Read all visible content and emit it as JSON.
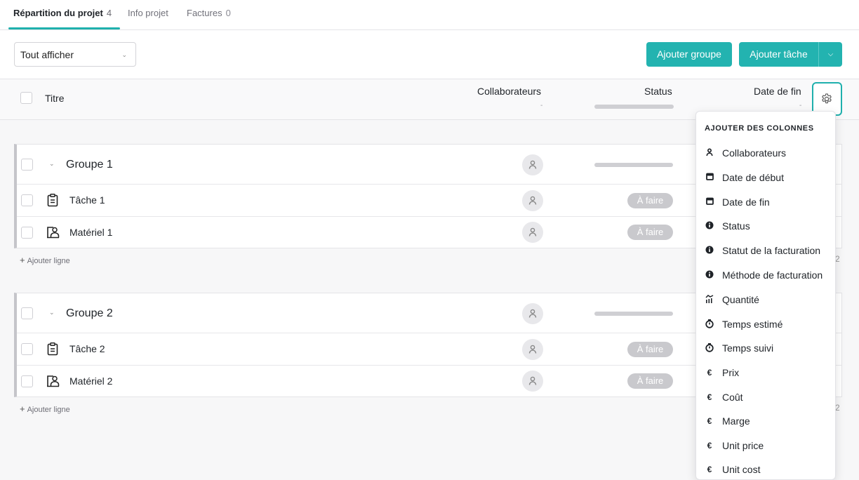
{
  "tabs": [
    {
      "label": "Répartition du projet",
      "count": "4"
    },
    {
      "label": "Info projet",
      "count": ""
    },
    {
      "label": "Factures",
      "count": "0"
    }
  ],
  "toolbar": {
    "filter_value": "Tout afficher",
    "add_group_label": "Ajouter groupe",
    "add_task_label": "Ajouter tâche"
  },
  "columns": {
    "title": "Titre",
    "collaborators": "Collaborateurs",
    "collaborators_sub": "-",
    "status": "Status",
    "end_date": "Date de fin",
    "end_date_sub": "-"
  },
  "groups": [
    {
      "name": "Groupe 1",
      "rows": [
        {
          "icon": "clipboard-icon",
          "title": "Tâche 1",
          "status": "À faire"
        },
        {
          "icon": "material-icon",
          "title": "Matériel 1",
          "status": "À faire"
        }
      ],
      "add_line": "Ajouter ligne"
    },
    {
      "name": "Groupe 2",
      "rows": [
        {
          "icon": "clipboard-icon",
          "title": "Tâche 2",
          "status": "À faire"
        },
        {
          "icon": "material-icon",
          "title": "Matériel 2",
          "status": "À faire"
        }
      ],
      "add_line": "Ajouter ligne"
    }
  ],
  "column_menu": {
    "title": "AJOUTER DES COLONNES",
    "items": [
      {
        "icon": "person-icon",
        "label": "Collaborateurs"
      },
      {
        "icon": "calendar-icon",
        "label": "Date de début"
      },
      {
        "icon": "calendar-icon",
        "label": "Date de fin"
      },
      {
        "icon": "info-icon",
        "label": "Status"
      },
      {
        "icon": "info-icon",
        "label": "Statut de la facturation"
      },
      {
        "icon": "info-icon",
        "label": "Méthode de facturation"
      },
      {
        "icon": "quantity-icon",
        "label": "Quantité"
      },
      {
        "icon": "timer-icon",
        "label": "Temps estimé"
      },
      {
        "icon": "timer-icon",
        "label": "Temps suivi"
      },
      {
        "icon": "euro-icon",
        "label": "Prix"
      },
      {
        "icon": "euro-icon",
        "label": "Coût"
      },
      {
        "icon": "euro-icon",
        "label": "Marge"
      },
      {
        "icon": "euro-icon",
        "label": "Unit price"
      },
      {
        "icon": "euro-icon",
        "label": "Unit cost"
      }
    ]
  },
  "peek_values": [
    "2",
    "2"
  ],
  "colors": {
    "accent": "#23b3b0",
    "status_pill": "#c9c9cd"
  }
}
